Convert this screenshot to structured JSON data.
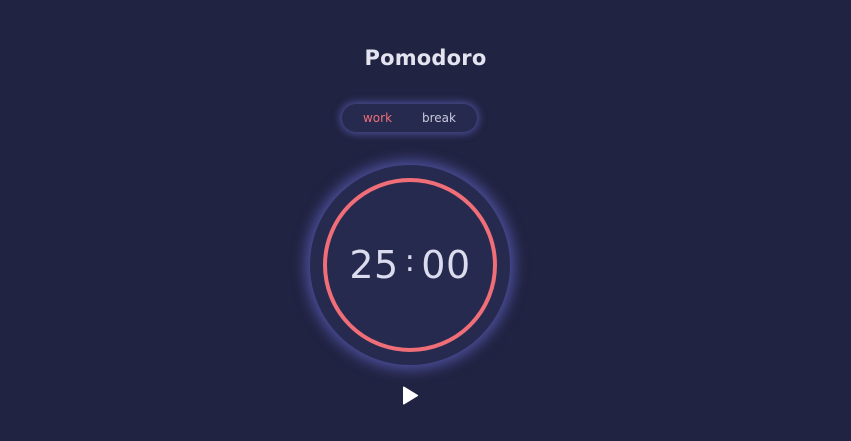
{
  "app": {
    "title": "Pomodoro"
  },
  "modes": [
    {
      "label": "work",
      "active": true
    },
    {
      "label": "break",
      "active": false
    }
  ],
  "timer": {
    "minutes": "25",
    "separator": ":",
    "seconds": "00",
    "progress": 1.0
  },
  "controls": {
    "play_icon": "play-icon"
  },
  "colors": {
    "background": "#212342",
    "accent": "#ef6e77",
    "glow": "#6e73dc",
    "text": "#dcdcef"
  }
}
